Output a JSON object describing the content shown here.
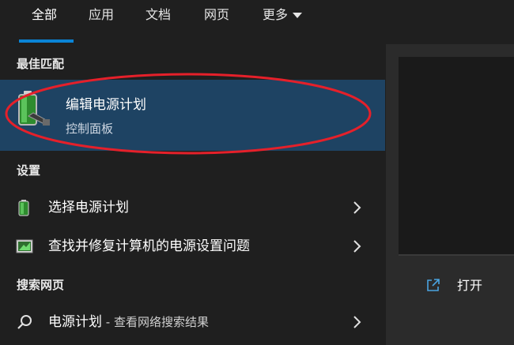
{
  "tabs": [
    {
      "label": "全部"
    },
    {
      "label": "应用"
    },
    {
      "label": "文档"
    },
    {
      "label": "网页"
    },
    {
      "label": "更多"
    }
  ],
  "best_match": {
    "heading": "最佳匹配",
    "title": "编辑电源计划",
    "subtitle": "控制面板",
    "icon": "battery-icon"
  },
  "settings": {
    "heading": "设置",
    "items": [
      {
        "label": "选择电源计划",
        "icon": "battery-icon"
      },
      {
        "label": "查找并修复计算机的电源设置问题",
        "icon": "troubleshoot-icon"
      }
    ]
  },
  "web": {
    "heading": "搜索网页",
    "items": [
      {
        "label": "电源计划",
        "suffix": " - 查看网络搜索结果",
        "icon": "search-icon"
      }
    ]
  },
  "actions": {
    "open_label": "打开"
  },
  "colors": {
    "accent": "#0a84d6",
    "selection": "#1e4363",
    "annotation": "#e5202a"
  }
}
